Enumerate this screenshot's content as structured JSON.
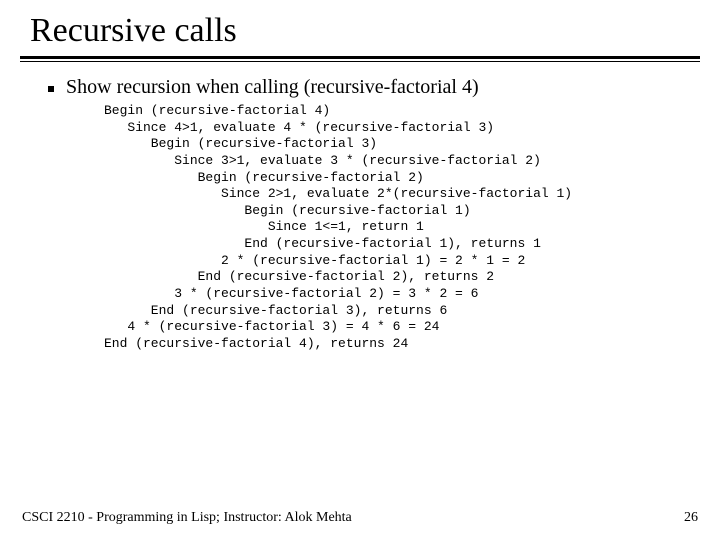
{
  "title": "Recursive calls",
  "bullet": "Show recursion when calling (recursive-factorial 4)",
  "code": "Begin (recursive-factorial 4)\n   Since 4>1, evaluate 4 * (recursive-factorial 3)\n      Begin (recursive-factorial 3)\n         Since 3>1, evaluate 3 * (recursive-factorial 2)\n            Begin (recursive-factorial 2)\n               Since 2>1, evaluate 2*(recursive-factorial 1)\n                  Begin (recursive-factorial 1)\n                     Since 1<=1, return 1\n                  End (recursive-factorial 1), returns 1\n               2 * (recursive-factorial 1) = 2 * 1 = 2\n            End (recursive-factorial 2), returns 2\n         3 * (recursive-factorial 2) = 3 * 2 = 6\n      End (recursive-factorial 3), returns 6\n   4 * (recursive-factorial 3) = 4 * 6 = 24\nEnd (recursive-factorial 4), returns 24",
  "footer": {
    "left": "CSCI 2210 - Programming in Lisp; Instructor: Alok Mehta",
    "right": "26"
  }
}
